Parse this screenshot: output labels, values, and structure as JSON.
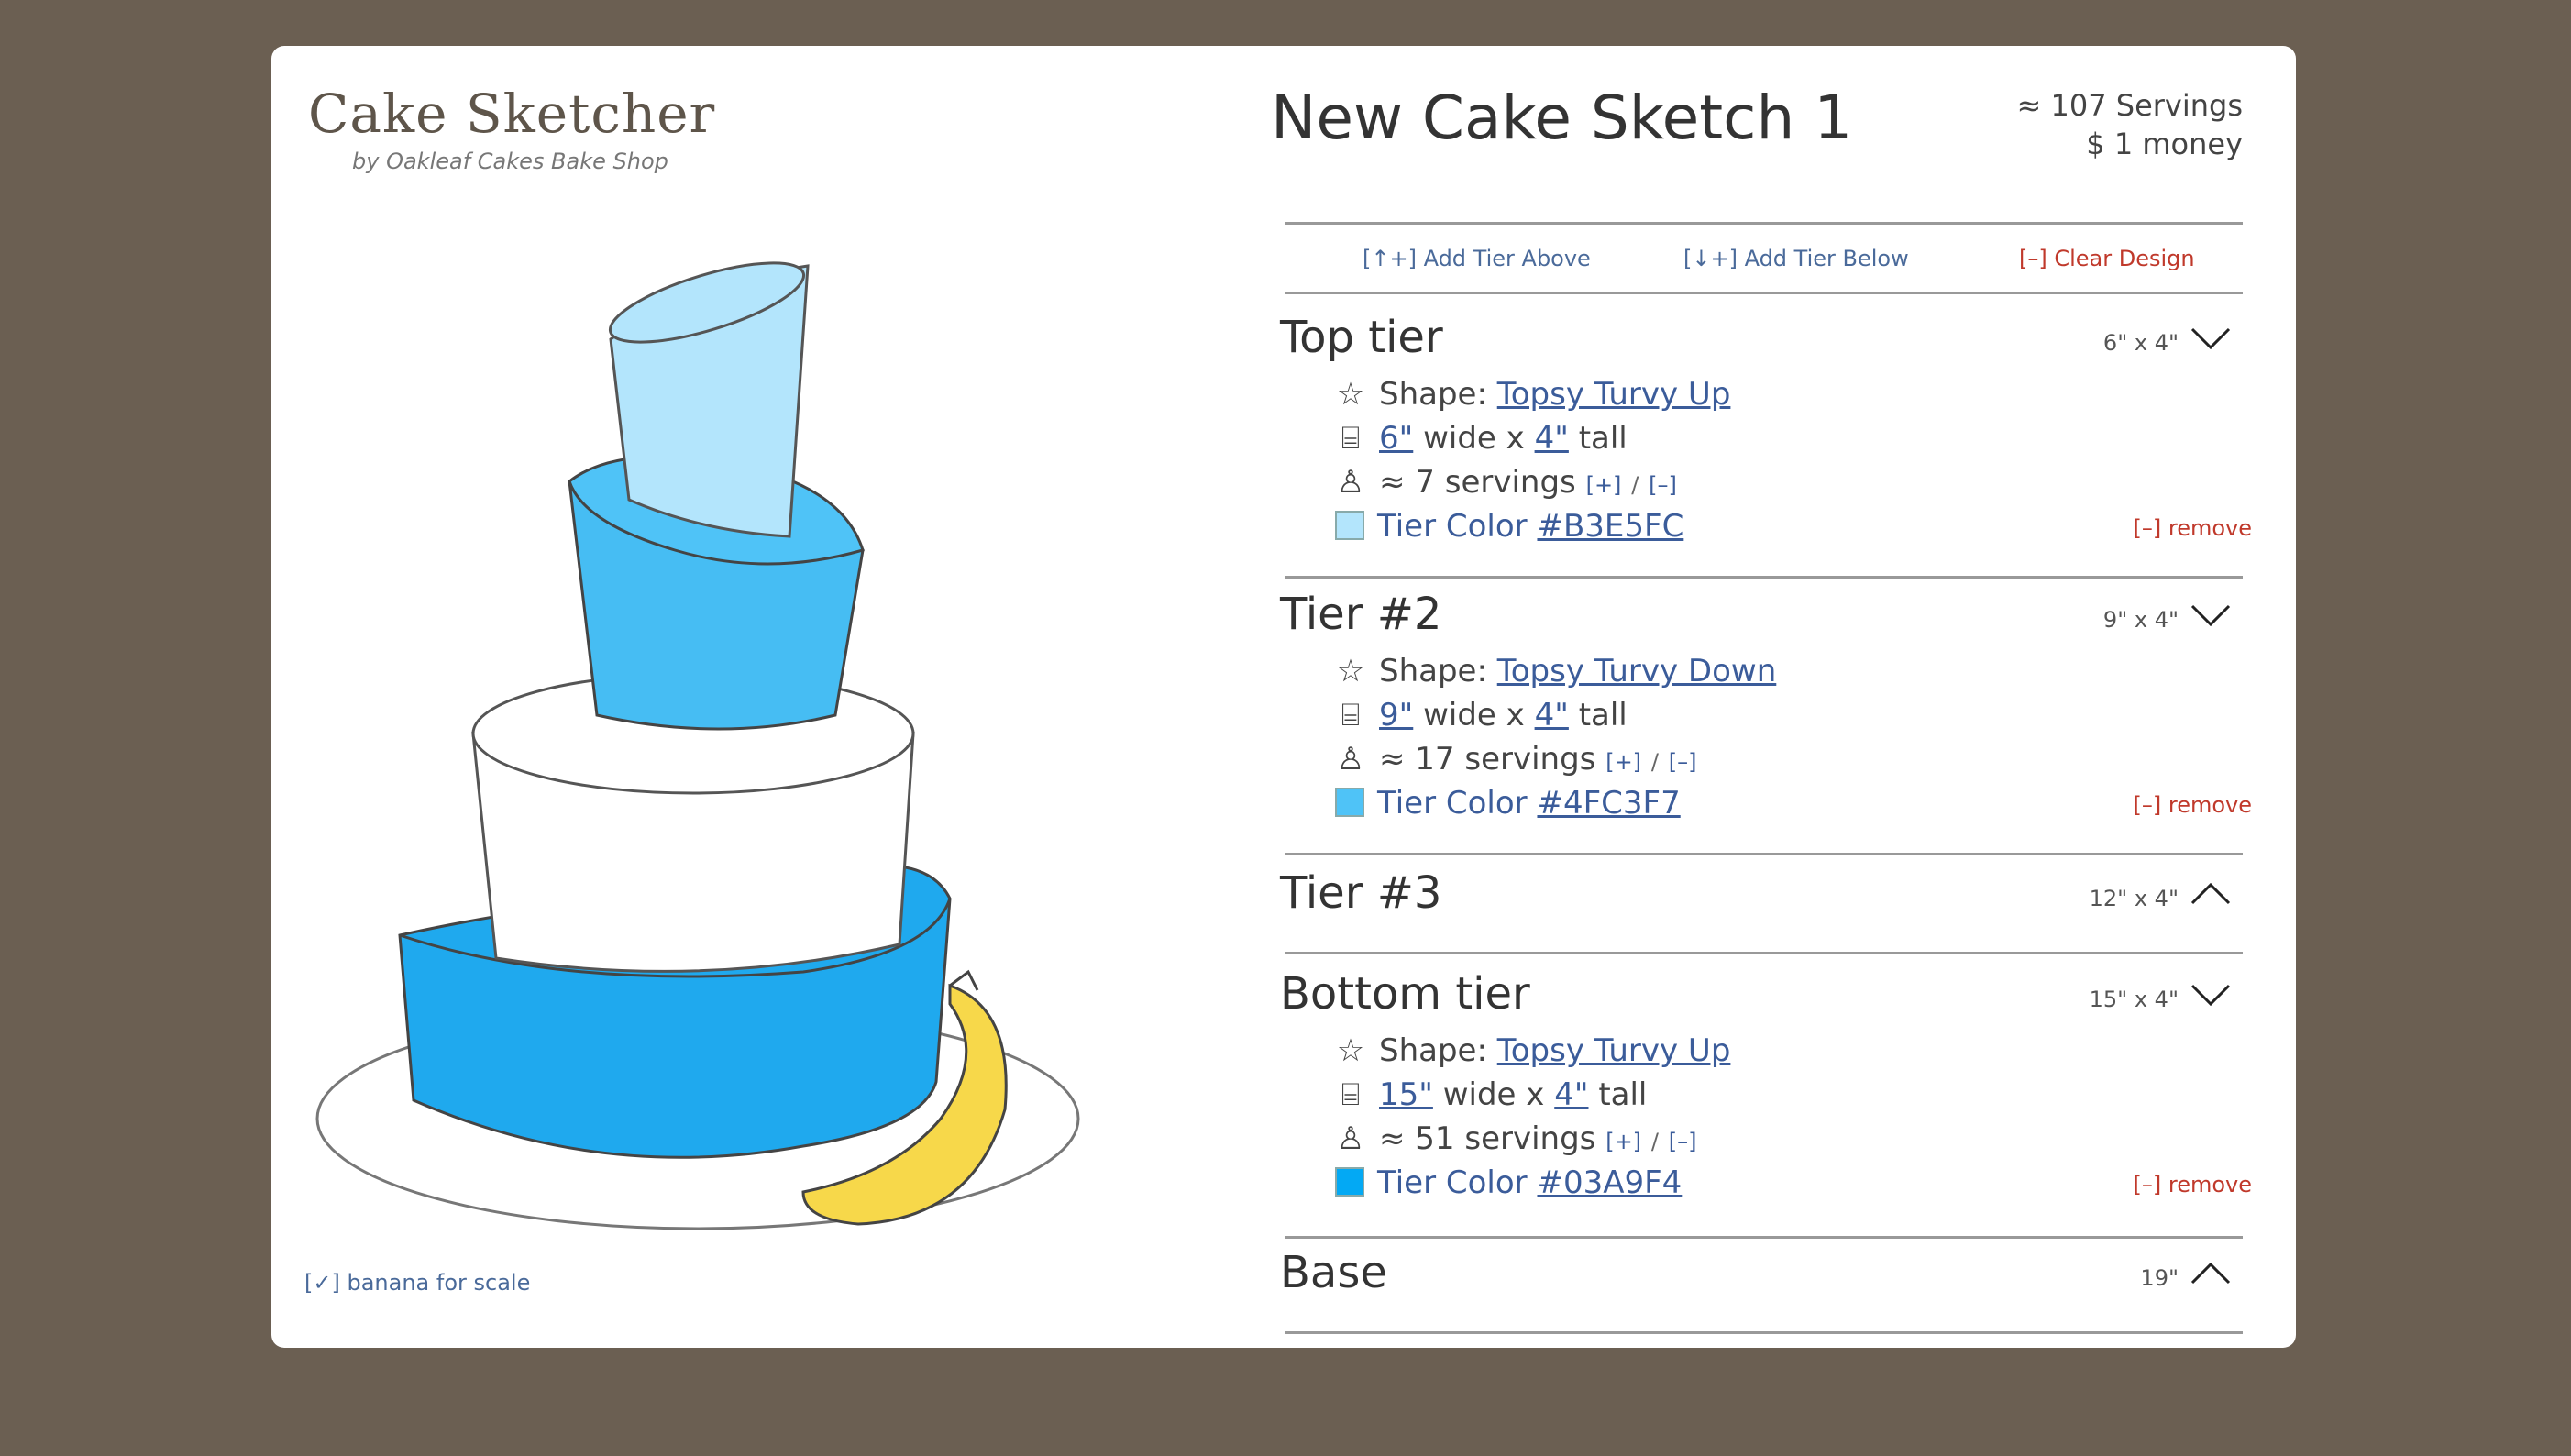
{
  "app": {
    "title": "Cake Sketcher",
    "byline": "by Oakleaf Cakes Bake Shop"
  },
  "banana_toggle": "[✓] banana for scale",
  "sketch": {
    "title": "New Cake Sketch 1",
    "servings": "≈ 107 Servings",
    "price": "$ 1 money"
  },
  "actions": {
    "add_above": "[↑+] Add Tier Above",
    "add_below": "[↓+] Add Tier Below",
    "clear": "[–] Clear Design"
  },
  "tiers": [
    {
      "title": "Top tier",
      "dims": "6\" x 4\"",
      "expanded": true,
      "shape_label": "Shape:",
      "shape": "Topsy Turvy Up",
      "width": "6\"",
      "wide_label": "wide x",
      "height": "4\"",
      "tall_label": "tall",
      "servings": "≈ 7 servings",
      "plus": "[+]",
      "slash": "/",
      "minus": "[–]",
      "color_label": "Tier Color",
      "color": "#B3E5FC",
      "remove": "[–] remove"
    },
    {
      "title": "Tier #2",
      "dims": "9\" x 4\"",
      "expanded": true,
      "shape_label": "Shape:",
      "shape": "Topsy Turvy Down",
      "width": "9\"",
      "wide_label": "wide x",
      "height": "4\"",
      "tall_label": "tall",
      "servings": "≈ 17 servings",
      "plus": "[+]",
      "slash": "/",
      "minus": "[–]",
      "color_label": "Tier Color",
      "color": "#4FC3F7",
      "remove": "[–] remove"
    },
    {
      "title": "Tier #3",
      "dims": "12\" x 4\"",
      "expanded": false
    },
    {
      "title": "Bottom tier",
      "dims": "15\" x 4\"",
      "expanded": true,
      "shape_label": "Shape:",
      "shape": "Topsy Turvy Up",
      "width": "15\"",
      "wide_label": "wide x",
      "height": "4\"",
      "tall_label": "tall",
      "servings": "≈ 51 servings",
      "plus": "[+]",
      "slash": "/",
      "minus": "[–]",
      "color_label": "Tier Color",
      "color": "#03A9F4",
      "remove": "[–] remove"
    }
  ],
  "base": {
    "title": "Base",
    "dims": "19\"",
    "expanded": false
  },
  "colors": {
    "tier3": "#FFFFFF",
    "banana": "#F7D84A",
    "outline": "#555555"
  },
  "icons": {
    "shape": "star-icon",
    "size": "cylinder-icon",
    "servings": "person-icon",
    "collapse": "chevron-icon"
  }
}
